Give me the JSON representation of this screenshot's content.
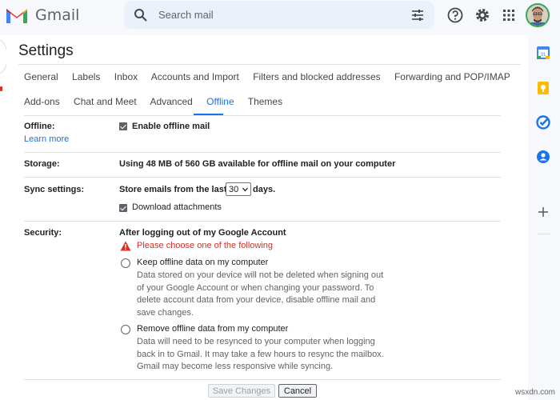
{
  "app": {
    "name": "Gmail"
  },
  "search": {
    "placeholder": "Search mail"
  },
  "page": {
    "title": "Settings"
  },
  "tabs": {
    "row1": [
      "General",
      "Labels",
      "Inbox",
      "Accounts and Import",
      "Filters and blocked addresses",
      "Forwarding and POP/IMAP"
    ],
    "row2": [
      "Add-ons",
      "Chat and Meet",
      "Advanced",
      "Offline",
      "Themes"
    ],
    "active": "Offline"
  },
  "offline": {
    "label": "Offline:",
    "learn_more": "Learn more",
    "enable_label": "Enable offline mail",
    "enabled": true
  },
  "storage": {
    "label": "Storage:",
    "text": "Using 48 MB of 560 GB available for offline mail on your computer"
  },
  "sync": {
    "label": "Sync settings:",
    "store_prefix": "Store emails from the last",
    "days_value": "30",
    "store_suffix": "days.",
    "download_label": "Download attachments",
    "download_checked": true
  },
  "security": {
    "label": "Security:",
    "heading": "After logging out of my Google Account",
    "warning": "Please choose one of the following",
    "keep": {
      "title": "Keep offline data on my computer",
      "lines": [
        "Data stored on your device will not be deleted when signing out",
        "of your Google Account or when changing your password. To",
        "delete account data from your device, disable offline mail and",
        "save changes."
      ]
    },
    "remove": {
      "title": "Remove offline data from my computer",
      "lines": [
        "Data will need to be resynced to your computer when logging",
        "back in to Gmail. It may take a few hours to resync the mailbox.",
        "Gmail may become less responsive while syncing."
      ]
    }
  },
  "buttons": {
    "save": "Save Changes",
    "cancel": "Cancel"
  },
  "watermark": "wsxdn.com",
  "colors": {
    "accent": "#1a73e8",
    "warning": "#d93025",
    "text": "#202124",
    "muted": "#5f6368"
  }
}
